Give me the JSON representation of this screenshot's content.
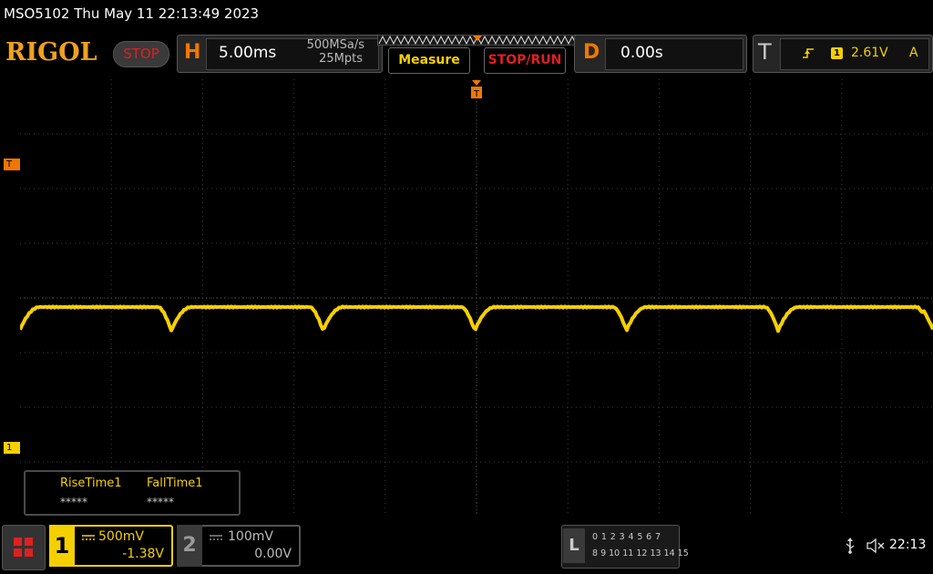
{
  "window": {
    "title": "MSO5102  Thu May 11 22:13:49 2023"
  },
  "toolbar": {
    "logo": "RIGOL",
    "run_state": "STOP",
    "horizontal": {
      "letter": "H",
      "timebase": "5.00ms",
      "sample_rate": "500MSa/s",
      "memory_depth": "25Mpts"
    },
    "measure_label": "Measure",
    "stoprun_label": "STOP/RUN",
    "delay": {
      "letter": "D",
      "value": "0.00s"
    },
    "trigger": {
      "letter": "T",
      "channel": "1",
      "level": "2.61V",
      "mode": "A"
    }
  },
  "screen": {
    "trigger_level_marker": "T",
    "ch1_marker": "1"
  },
  "measurements": [
    {
      "label": "RiseTime1",
      "value": "*****"
    },
    {
      "label": "FallTime1",
      "value": "*****"
    }
  ],
  "channels": {
    "ch1": {
      "number": "1",
      "scale": "500mV",
      "offset": "-1.38V",
      "color": "#f5d000"
    },
    "ch2": {
      "number": "2",
      "scale": "100mV",
      "offset": "0.00V",
      "color": "#888888"
    }
  },
  "logic": {
    "letter": "L",
    "row1": "0 1 2 3   4 5 6 7",
    "row2": "8  9 10 11  12 13 14 15"
  },
  "status": {
    "clock": "22:13"
  },
  "icons": {
    "menu": "menu-grid-icon",
    "usb": "usb-icon",
    "mute": "speaker-muted-icon",
    "trigger_edge": "rising-edge-icon"
  }
}
